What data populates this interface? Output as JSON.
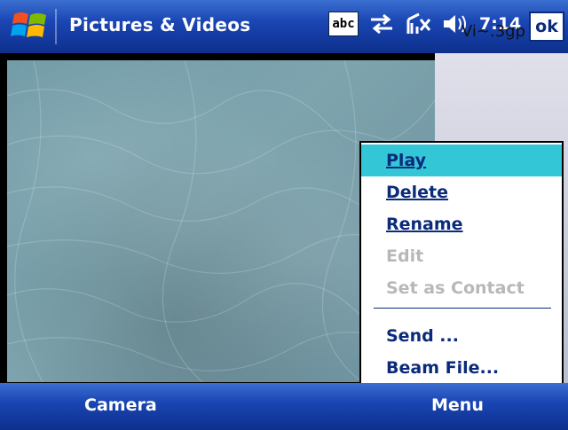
{
  "header": {
    "title": "Pictures & Videos",
    "input_indicator": "abc",
    "time": "7:14",
    "ok_label": "ok"
  },
  "file": {
    "name": "Vi~.3gp"
  },
  "context_menu": {
    "items": [
      {
        "label": "Play",
        "state": "highlighted"
      },
      {
        "label": "Delete",
        "state": "enabled"
      },
      {
        "label": "Rename",
        "state": "enabled"
      },
      {
        "label": "Edit",
        "state": "disabled"
      },
      {
        "label": "Set as Contact",
        "state": "disabled"
      },
      {
        "label": "Send ...",
        "state": "enabled"
      },
      {
        "label": "Beam File...",
        "state": "enabled"
      }
    ]
  },
  "softkeys": {
    "left": "Camera",
    "right": "Menu"
  },
  "colors": {
    "titlebar": "#1a46b4",
    "highlight": "#33c6d6",
    "menu_text": "#0a2a7a",
    "disabled_text": "#b8b8b8"
  }
}
